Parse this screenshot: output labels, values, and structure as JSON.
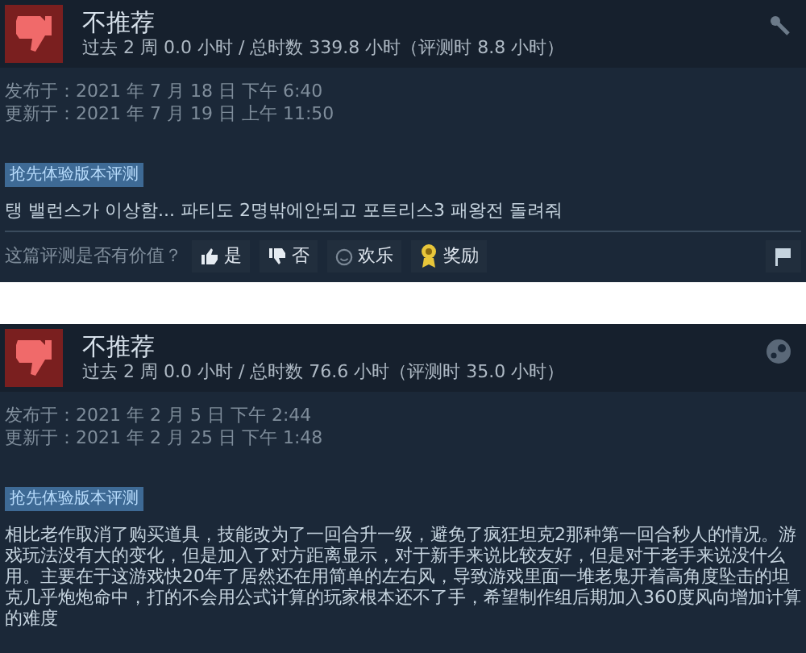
{
  "reviews": [
    {
      "verdict": "不推荐",
      "hours": "过去 2 周 0.0 小时 / 总时数 339.8 小时（评测时 8.8 小时）",
      "corner": {
        "kind": "wrench"
      },
      "posted": "发布于：2021 年 7 月 18 日 下午 6:40",
      "updated": "更新于：2021 年 7 月 19 日 上午 11:50",
      "tag": "抢先体验版本评测",
      "body": "탱 밸런스가 이상함... 파티도 2명밖에안되고 포트리스3 패왕전 돌려줘",
      "helpful": {
        "prompt": "这篇评测是否有价值？",
        "buttons": [
          {
            "kind": "up",
            "label": "是"
          },
          {
            "kind": "down",
            "label": "否"
          },
          {
            "kind": "funny",
            "label": "欢乐"
          },
          {
            "kind": "award",
            "label": "奖励"
          }
        ]
      }
    },
    {
      "verdict": "不推荐",
      "hours": "过去 2 周 0.0 小时 / 总时数 76.6 小时（评测时 35.0 小时）",
      "corner": {
        "kind": "steam"
      },
      "posted": "发布于：2021 年 2 月 5 日 下午 2:44",
      "updated": "更新于：2021 年 2 月 25 日 下午 1:48",
      "tag": "抢先体验版本评测",
      "body": "相比老作取消了购买道具，技能改为了一回合升一级，避免了疯狂坦克2那种第一回合秒人的情况。游戏玩法没有大的变化，但是加入了对方距离显示，对于新手来说比较友好，但是对于老手来说没什么用。主要在于这游戏快20年了居然还在用简单的左右风，导致游戏里面一堆老鬼开着高角度坠击的坦克几乎炮炮命中，打的不会用公式计算的玩家根本还不了手，希望制作组后期加入360度风向增加计算的难度"
    }
  ]
}
